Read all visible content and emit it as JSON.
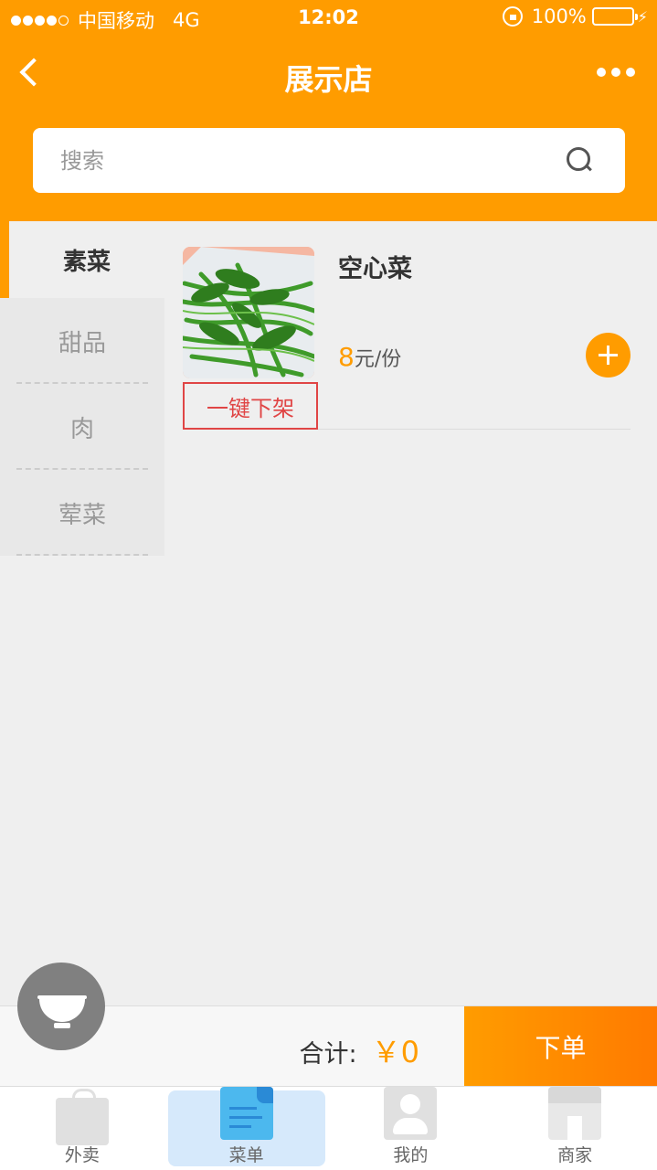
{
  "status_bar": {
    "carrier": "中国移动",
    "network": "4G",
    "time": "12:02",
    "battery": "100%"
  },
  "header": {
    "title": "展示店"
  },
  "search": {
    "placeholder": "搜索"
  },
  "categories": [
    {
      "label": "素菜",
      "active": true
    },
    {
      "label": "甜品",
      "active": false
    },
    {
      "label": "肉",
      "active": false
    },
    {
      "label": "荤菜",
      "active": false
    }
  ],
  "dishes": [
    {
      "name": "空心菜",
      "price_value": "8",
      "price_unit": "元/份",
      "action_label": "一键下架"
    }
  ],
  "cart": {
    "total_label": "合计:",
    "total_amount": "￥0",
    "order_label": "下单"
  },
  "tabs": [
    {
      "label": "外卖",
      "icon": "bag-icon",
      "active": false
    },
    {
      "label": "菜单",
      "icon": "menu-doc-icon",
      "active": true
    },
    {
      "label": "我的",
      "icon": "person-icon",
      "active": false
    },
    {
      "label": "商家",
      "icon": "shop-icon",
      "active": false
    }
  ],
  "colors": {
    "accent": "#ff9c00",
    "tab_active_bg": "#d6e9fb",
    "offshelf_red": "#e04545"
  }
}
